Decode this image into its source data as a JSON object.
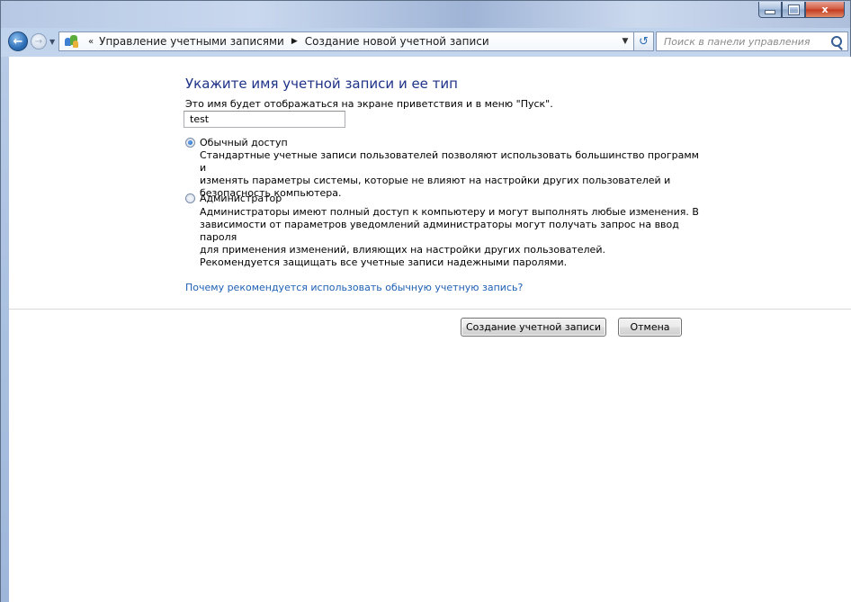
{
  "window": {
    "minimize_icon": "minimize-icon",
    "maximize_icon": "maximize-icon",
    "close_label": "x"
  },
  "nav": {
    "back_icon": "back-arrow-icon",
    "forward_icon": "forward-arrow-icon",
    "breadcrumb_prefix": "«",
    "breadcrumb": [
      "Управление учетными записями",
      "Создание новой учетной записи"
    ],
    "search_placeholder": "Поиск в панели управления"
  },
  "main": {
    "heading": "Укажите имя учетной записи и ее тип",
    "description": "Это имя будет отображаться на экране приветствия и в меню \"Пуск\".",
    "account_name_value": "test",
    "options": [
      {
        "label": "Обычный доступ",
        "selected": true,
        "description_lines": [
          "Стандартные учетные записи пользователей позволяют использовать большинство программ и",
          "изменять параметры системы, которые не влияют на настройки других пользователей и",
          "безопасность компьютера."
        ]
      },
      {
        "label": "Администратор",
        "selected": false,
        "description_lines": [
          "Администраторы имеют полный доступ к компьютеру и могут выполнять любые изменения. В",
          "зависимости от параметров уведомлений администраторы могут получать запрос на ввод пароля",
          "для применения изменений, влияющих на настройки других пользователей."
        ]
      }
    ],
    "recommendation": "Рекомендуется защищать все учетные записи надежными паролями.",
    "help_link": "Почему рекомендуется использовать обычную учетную запись?"
  },
  "buttons": {
    "create": "Создание учетной записи",
    "cancel": "Отмена"
  }
}
